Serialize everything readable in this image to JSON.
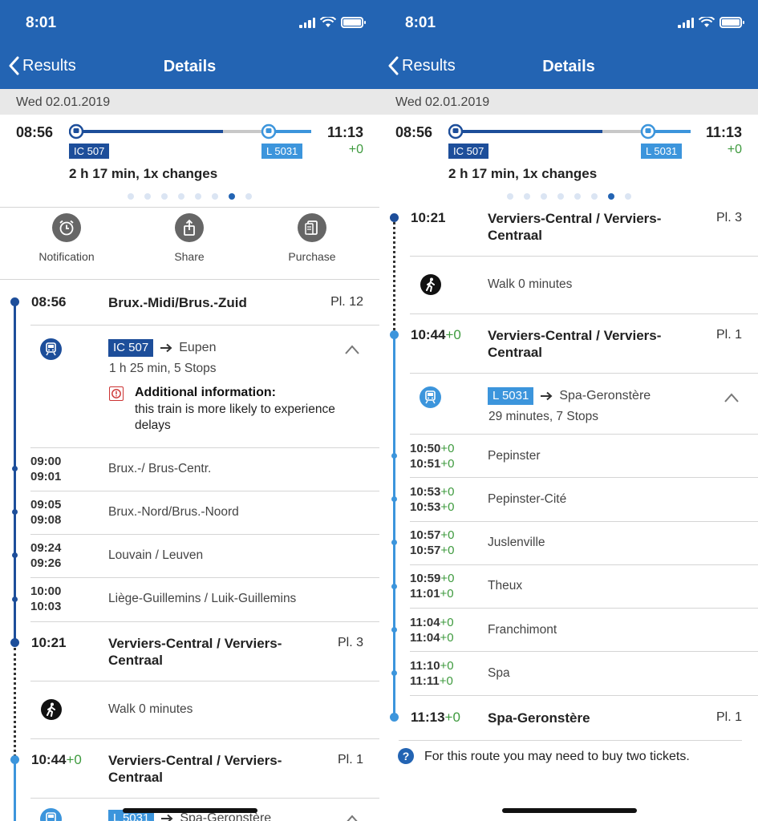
{
  "status_bar": {
    "time": "8:01"
  },
  "nav": {
    "back_label": "Results",
    "title": "Details"
  },
  "date": "Wed 02.01.2019",
  "summary": {
    "departure": "08:56",
    "arrival": "11:13",
    "arrival_delay": "+0",
    "legs": [
      {
        "label": "IC 507",
        "color": "#1d4e9a"
      },
      {
        "label": "L 5031",
        "color": "#3c95dc"
      }
    ],
    "duration": "2 h 17 min,  1x changes",
    "page_dots": 8,
    "active_dot": 7
  },
  "actions": [
    {
      "label": "Notification",
      "icon": "alarm-clock-icon"
    },
    {
      "label": "Share",
      "icon": "share-icon"
    },
    {
      "label": "Purchase",
      "icon": "purchase-icon"
    }
  ],
  "left": {
    "start": {
      "time": "08:56",
      "station": "Brux.-Midi/Brus.-Zuid",
      "platform": "Pl. 12"
    },
    "leg1": {
      "train": "IC 507",
      "direction": "Eupen",
      "sub": "1 h 25 min, 5 Stops",
      "info_title": "Additional information:",
      "info_text": "this train is more likely to experience delays"
    },
    "stops": [
      {
        "arr": "09:00",
        "dep": "09:01",
        "name": "Brux.-/ Brus-Centr."
      },
      {
        "arr": "09:05",
        "dep": "09:08",
        "name": "Brux.-Nord/Brus.-Noord"
      },
      {
        "arr": "09:24",
        "dep": "09:26",
        "name": "Louvain / Leuven"
      },
      {
        "arr": "10:00",
        "dep": "10:03",
        "name": "Liège-Guillemins / Luik-Guillemins"
      }
    ],
    "transfer_arr": {
      "time": "10:21",
      "station_l1": "Verviers-Central / Verviers-",
      "station_l2": "Centraal",
      "platform": "Pl. 3"
    },
    "walk": "Walk 0  minutes",
    "transfer_dep": {
      "time": "10:44",
      "delay": "+0",
      "station_l1": "Verviers-Central / Verviers-",
      "station_l2": "Centraal",
      "platform": "Pl. 1"
    },
    "leg2_partial": {
      "train": "L 5031",
      "direction": "Spa-Geronstère"
    }
  },
  "right": {
    "transfer_arr": {
      "time": "10:21",
      "station_l1": "Verviers-Central / Verviers-",
      "station_l2": "Centraal",
      "platform": "Pl. 3"
    },
    "walk": "Walk 0  minutes",
    "transfer_dep": {
      "time": "10:44",
      "delay": "+0",
      "station_l1": "Verviers-Central / Verviers-",
      "station_l2": "Centraal",
      "platform": "Pl. 1"
    },
    "leg2": {
      "train": "L 5031",
      "direction": "Spa-Geronstère",
      "sub": "29  minutes, 7 Stops"
    },
    "stops": [
      {
        "arr": "10:50",
        "arr_d": "+0",
        "dep": "10:51",
        "dep_d": "+0",
        "name": "Pepinster"
      },
      {
        "arr": "10:53",
        "arr_d": "+0",
        "dep": "10:53",
        "dep_d": "+0",
        "name": "Pepinster-Cité"
      },
      {
        "arr": "10:57",
        "arr_d": "+0",
        "dep": "10:57",
        "dep_d": "+0",
        "name": "Juslenville"
      },
      {
        "arr": "10:59",
        "arr_d": "+0",
        "dep": "11:01",
        "dep_d": "+0",
        "name": "Theux"
      },
      {
        "arr": "11:04",
        "arr_d": "+0",
        "dep": "11:04",
        "dep_d": "+0",
        "name": "Franchimont"
      },
      {
        "arr": "11:10",
        "arr_d": "+0",
        "dep": "11:11",
        "dep_d": "+0",
        "name": "Spa"
      }
    ],
    "end": {
      "time": "11:13",
      "delay": "+0",
      "station": "Spa-Geronstère",
      "platform": "Pl. 1"
    },
    "hint": "For this route you may need to buy two tickets."
  },
  "colors": {
    "header": "#2364b3",
    "leg1": "#1d4e9a",
    "leg2": "#3c95dc",
    "delay_green": "#3e9a3e"
  }
}
